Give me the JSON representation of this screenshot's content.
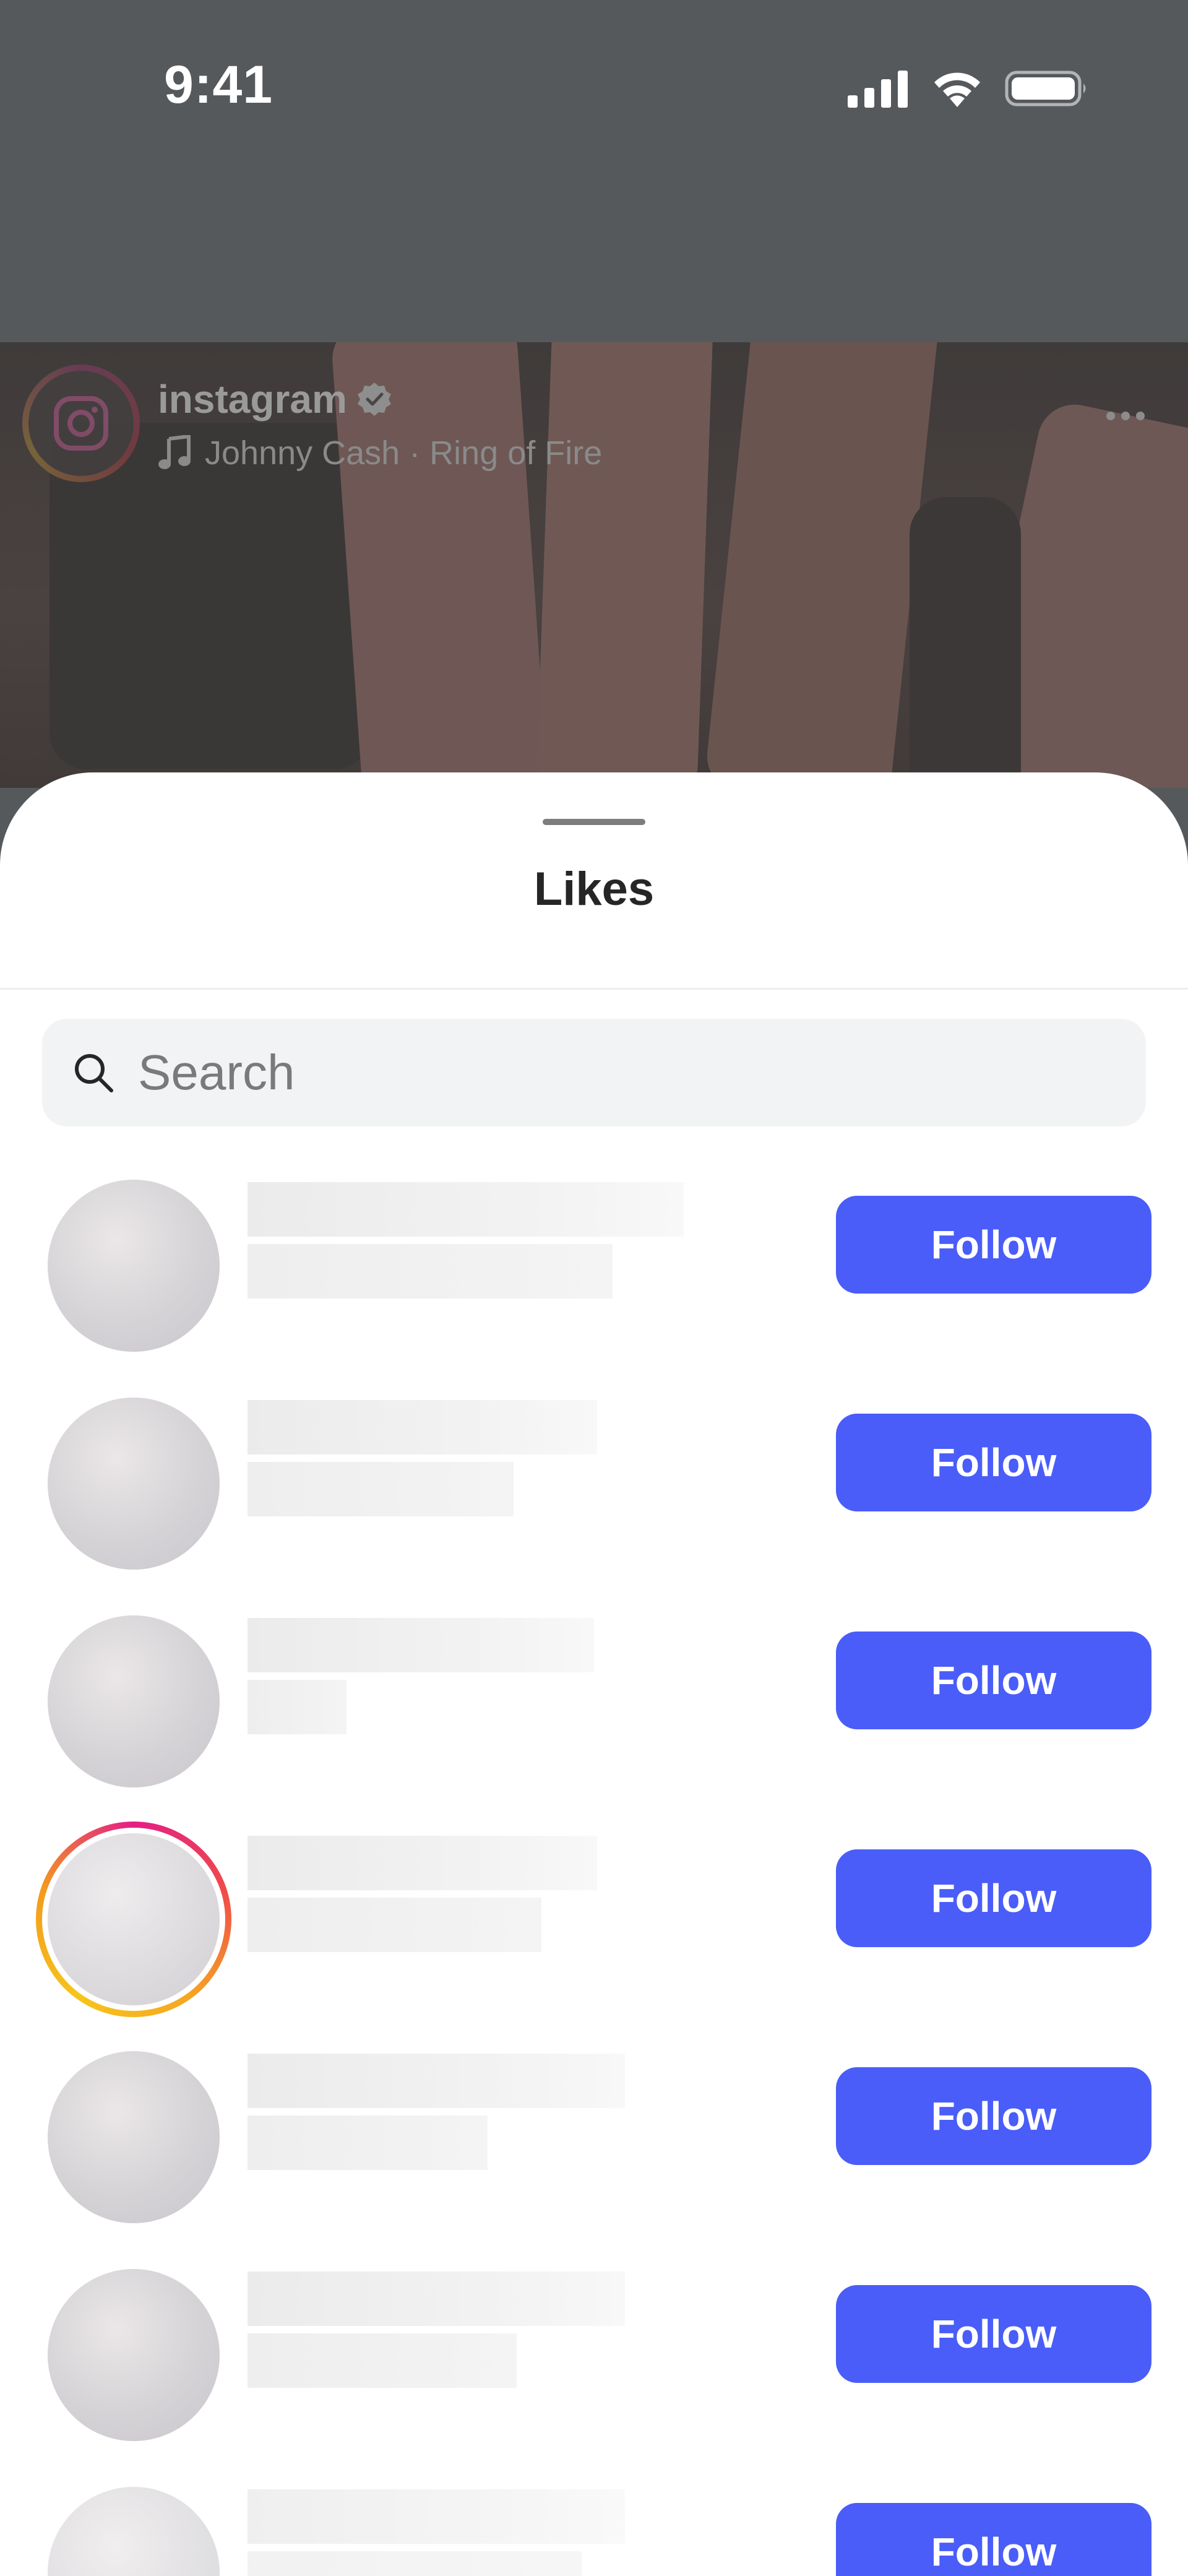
{
  "status_bar": {
    "time": "9:41",
    "icons": [
      "cellular-icon",
      "wifi-icon",
      "battery-icon"
    ]
  },
  "post": {
    "username": "instagram",
    "verified": true,
    "audio": "Johnny Cash · Ring of Fire",
    "icons": [
      "instagram-logo-icon",
      "verified-badge-icon",
      "music-note-icon",
      "more-icon"
    ]
  },
  "likes_sheet": {
    "title": "Likes",
    "search": {
      "placeholder": "Search",
      "value": ""
    },
    "rows": [
      {
        "follow_label": "Follow",
        "has_story": false
      },
      {
        "follow_label": "Follow",
        "has_story": false
      },
      {
        "follow_label": "Follow",
        "has_story": false
      },
      {
        "follow_label": "Follow",
        "has_story": true
      },
      {
        "follow_label": "Follow",
        "has_story": false
      },
      {
        "follow_label": "Follow",
        "has_story": false
      },
      {
        "follow_label": "Follow",
        "has_story": false
      }
    ]
  },
  "colors": {
    "follow_button": "#4a5df9",
    "story_ring_start": "#e31e86",
    "story_ring_end": "#f7c51a",
    "backdrop": "#56595c"
  }
}
